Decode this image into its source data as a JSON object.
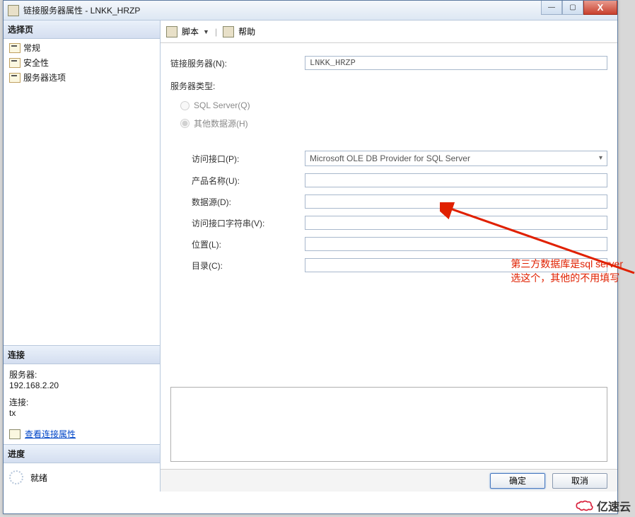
{
  "window": {
    "title": "链接服务器属性 - LNKK_HRZP"
  },
  "winControls": {
    "min": "—",
    "max": "▢",
    "close": "X"
  },
  "leftPane": {
    "selectHeader": "选择页",
    "navItems": [
      "常规",
      "安全性",
      "服务器选项"
    ],
    "connHeader": "连接",
    "serverLabel": "服务器:",
    "serverValue": "192.168.2.20",
    "connLabel": "连接:",
    "connValue": "tx",
    "viewLink": "查看连接属性",
    "progressHeader": "进度",
    "progressStatus": "就绪"
  },
  "toolbar": {
    "script": "脚本",
    "help": "帮助"
  },
  "form": {
    "linkedServerLabel": "链接服务器(N):",
    "linkedServerValue": "LNKK_HRZP",
    "serverTypeLabel": "服务器类型:",
    "radioSql": "SQL Server(Q)",
    "radioOther": "其他数据源(H)",
    "providerLabel": "访问接口(P):",
    "providerValue": "Microsoft OLE DB Provider for SQL Server",
    "productLabel": "产品名称(U):",
    "productValue": "",
    "dataSourceLabel": "数据源(D):",
    "dataSourceValue": "",
    "providerStringLabel": "访问接口字符串(V):",
    "providerStringValue": "",
    "locationLabel": "位置(L):",
    "locationValue": "",
    "catalogLabel": "目录(C):",
    "catalogValue": ""
  },
  "annotation": {
    "line1": "第三方数据库是sql server",
    "line2": "选这个，其他的不用填写"
  },
  "footer": {
    "ok": "确定",
    "cancel": "取消"
  },
  "watermark": "亿速云"
}
